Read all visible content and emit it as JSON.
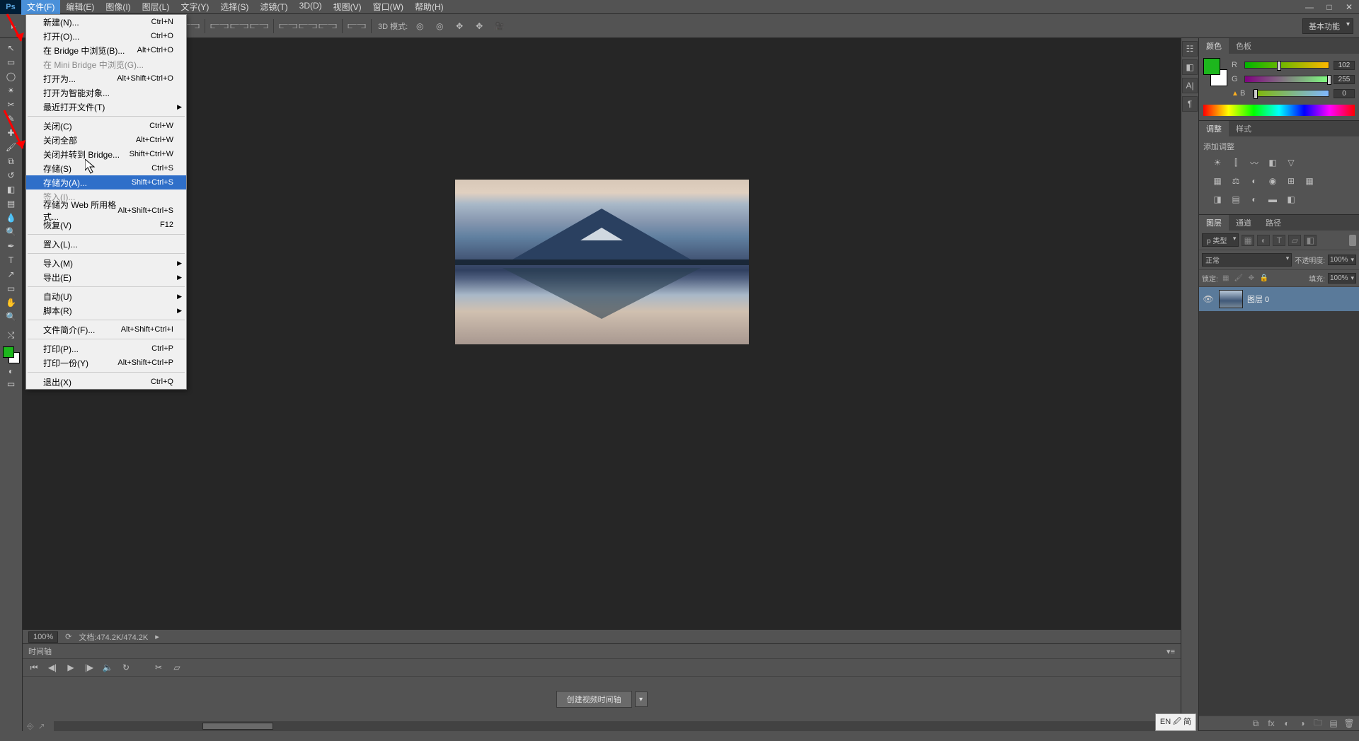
{
  "app": {
    "logo": "Ps"
  },
  "menus": [
    "文件(F)",
    "编辑(E)",
    "图像(I)",
    "图层(L)",
    "文字(Y)",
    "选择(S)",
    "滤镜(T)",
    "3D(D)",
    "视图(V)",
    "窗口(W)",
    "帮助(H)"
  ],
  "active_menu_index": 0,
  "window_controls": {
    "min": "—",
    "max": "□",
    "close": "✕"
  },
  "options_bar": {
    "mode_3d_label": "3D 模式:",
    "workspace": "基本功能"
  },
  "dropdown": {
    "groups": [
      [
        {
          "label": "新建(N)...",
          "shortcut": "Ctrl+N"
        },
        {
          "label": "打开(O)...",
          "shortcut": "Ctrl+O"
        },
        {
          "label": "在 Bridge 中浏览(B)...",
          "shortcut": "Alt+Ctrl+O"
        },
        {
          "label": "在 Mini Bridge 中浏览(G)...",
          "shortcut": "",
          "disabled": true
        },
        {
          "label": "打开为...",
          "shortcut": "Alt+Shift+Ctrl+O"
        },
        {
          "label": "打开为智能对象...",
          "shortcut": ""
        },
        {
          "label": "最近打开文件(T)",
          "shortcut": "",
          "submenu": true
        }
      ],
      [
        {
          "label": "关闭(C)",
          "shortcut": "Ctrl+W"
        },
        {
          "label": "关闭全部",
          "shortcut": "Alt+Ctrl+W"
        },
        {
          "label": "关闭并转到 Bridge...",
          "shortcut": "Shift+Ctrl+W"
        },
        {
          "label": "存储(S)",
          "shortcut": "Ctrl+S"
        },
        {
          "label": "存储为(A)...",
          "shortcut": "Shift+Ctrl+S",
          "highlighted": true
        },
        {
          "label": "签入(I)...",
          "shortcut": "",
          "disabled": true
        },
        {
          "label": "存储为 Web 所用格式...",
          "shortcut": "Alt+Shift+Ctrl+S"
        },
        {
          "label": "恢复(V)",
          "shortcut": "F12"
        }
      ],
      [
        {
          "label": "置入(L)...",
          "shortcut": ""
        }
      ],
      [
        {
          "label": "导入(M)",
          "shortcut": "",
          "submenu": true
        },
        {
          "label": "导出(E)",
          "shortcut": "",
          "submenu": true
        }
      ],
      [
        {
          "label": "自动(U)",
          "shortcut": "",
          "submenu": true
        },
        {
          "label": "脚本(R)",
          "shortcut": "",
          "submenu": true
        }
      ],
      [
        {
          "label": "文件简介(F)...",
          "shortcut": "Alt+Shift+Ctrl+I"
        }
      ],
      [
        {
          "label": "打印(P)...",
          "shortcut": "Ctrl+P"
        },
        {
          "label": "打印一份(Y)",
          "shortcut": "Alt+Shift+Ctrl+P"
        }
      ],
      [
        {
          "label": "退出(X)",
          "shortcut": "Ctrl+Q"
        }
      ]
    ]
  },
  "status": {
    "zoom": "100%",
    "doc_info": "文档:474.2K/474.2K"
  },
  "timeline": {
    "title": "时间轴",
    "create_label": "创建视频时间轴"
  },
  "color_panel": {
    "tab1": "颜色",
    "tab2": "色板",
    "r": "R",
    "g": "G",
    "b": "B",
    "rv": "102",
    "gv": "255",
    "bv": "0"
  },
  "adjust_panel": {
    "tab1": "调整",
    "tab2": "样式",
    "label": "添加调整"
  },
  "layers_panel": {
    "tab1": "图层",
    "tab2": "通道",
    "tab3": "路径",
    "filter_kind": "p 类型",
    "blend_mode": "正常",
    "opacity_label": "不透明度:",
    "opacity": "100%",
    "lock_label": "锁定:",
    "fill_label": "填充:",
    "fill": "100%",
    "layer0": "图层 0"
  },
  "ime": "EN 🖉 简"
}
